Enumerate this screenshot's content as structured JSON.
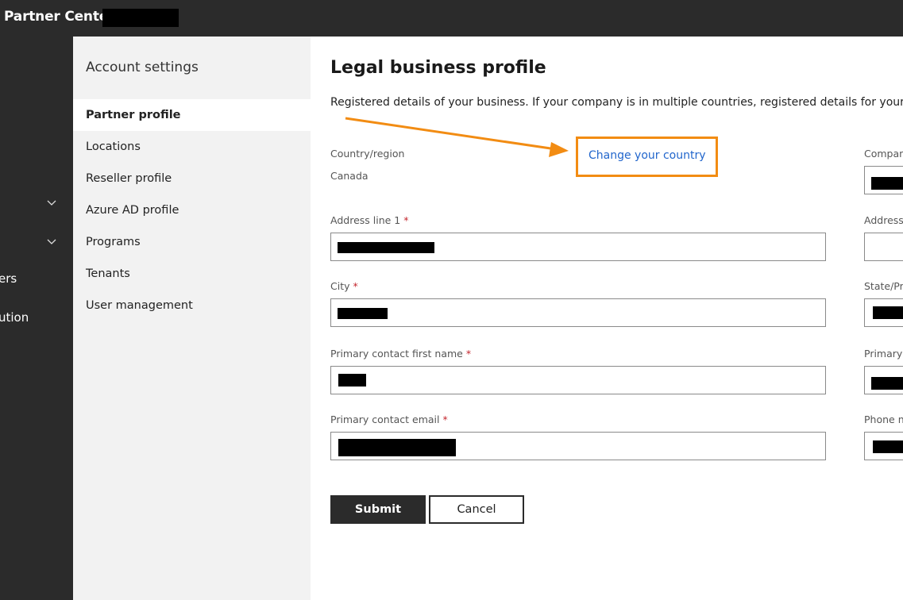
{
  "app": {
    "title": "Partner Center"
  },
  "left_nav": {
    "partial_items": [
      "ers",
      "ution"
    ]
  },
  "settings_nav": {
    "title": "Account settings",
    "items": [
      {
        "label": "Partner profile",
        "active": true
      },
      {
        "label": "Locations"
      },
      {
        "label": "Reseller profile"
      },
      {
        "label": "Azure AD profile"
      },
      {
        "label": "Programs"
      },
      {
        "label": "Tenants"
      },
      {
        "label": "User management"
      }
    ]
  },
  "main": {
    "title": "Legal business profile",
    "description": "Registered details of your business. If your company is in multiple countries, registered details for your primar",
    "country_label": "Country/region",
    "country_value": "Canada",
    "change_country_link": "Change your country",
    "fields": {
      "address_line_1": "Address line 1",
      "city": "City",
      "contact_first_name": "Primary contact first name",
      "contact_email": "Primary contact email"
    },
    "right_column_labels": {
      "company": "Company",
      "address": "Address",
      "state": "State/Pro",
      "primary": "Primary c",
      "phone": "Phone nu"
    },
    "required_mark": "*",
    "submit_label": "Submit",
    "cancel_label": "Cancel"
  },
  "colors": {
    "topbar": "#2b2b2b",
    "nav_bg": "#f2f2f2",
    "link": "#2266cc",
    "highlight": "#f28c13",
    "required": "#c4262e"
  },
  "icons": [
    "chevron-down-icon",
    "arrow-annotation-icon"
  ]
}
